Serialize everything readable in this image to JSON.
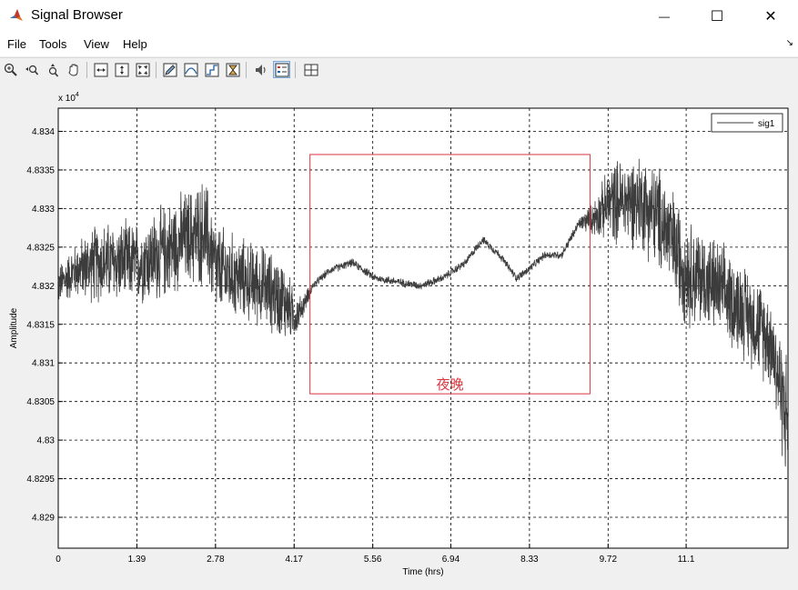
{
  "window": {
    "title": "Signal Browser",
    "minimize_glyph": "—",
    "maximize_glyph": "☐",
    "close_glyph": "✕"
  },
  "menu": [
    "File",
    "Tools",
    "View",
    "Help"
  ],
  "toolbar_icons": [
    "zoom-in-icon",
    "zoom-x-icon",
    "zoom-y-icon",
    "pan-hand-icon",
    "fit-horizontal-icon",
    "fit-vertical-icon",
    "fit-both-icon",
    "edit-annotation-icon",
    "waveform-icon",
    "step-icon",
    "hourglass-icon",
    "speaker-icon",
    "legend-toggle-icon",
    "grid-layout-icon"
  ],
  "colors": {
    "signal": "#3c3c3c",
    "annotation": "#d9363e",
    "grid": "#000000",
    "axes_bg": "#ffffff"
  },
  "chart_data": {
    "type": "line",
    "exponent_label": "x 10",
    "exponent_power": "4",
    "xlabel": "Time (hrs)",
    "ylabel": "Amplitude",
    "xlim": [
      0,
      12.9
    ],
    "ylim": [
      48286,
      48343
    ],
    "x_ticks": [
      0,
      1.39,
      2.78,
      4.17,
      5.56,
      6.94,
      8.33,
      9.72,
      11.1
    ],
    "x_tick_labels": [
      "0",
      "1.39",
      "2.78",
      "4.17",
      "5.56",
      "6.94",
      "8.33",
      "9.72",
      "11.1"
    ],
    "y_ticks": [
      48290,
      48295,
      48300,
      48305,
      48310,
      48315,
      48320,
      48325,
      48330,
      48335,
      48340
    ],
    "y_tick_labels": [
      "4.829",
      "4.8295",
      "4.83",
      "4.8305",
      "4.831",
      "4.8315",
      "4.832",
      "4.8325",
      "4.833",
      "4.8335",
      "4.834"
    ],
    "grid": true,
    "legend_position": "top-right",
    "series": [
      {
        "name": "sig1",
        "envelope": [
          [
            0.0,
            48320,
            3
          ],
          [
            0.3,
            48322,
            4
          ],
          [
            0.7,
            48323,
            6
          ],
          [
            1.0,
            48323,
            6
          ],
          [
            1.4,
            48323,
            6
          ],
          [
            1.8,
            48324,
            7
          ],
          [
            2.2,
            48326,
            7
          ],
          [
            2.6,
            48327,
            8
          ],
          [
            2.8,
            48322,
            7
          ],
          [
            3.2,
            48321,
            6
          ],
          [
            3.6,
            48320,
            6
          ],
          [
            4.0,
            48318,
            6
          ],
          [
            4.2,
            48316,
            3
          ],
          [
            4.3,
            48317,
            2
          ],
          [
            4.5,
            48320,
            0.6
          ],
          [
            4.8,
            48322,
            0.6
          ],
          [
            5.2,
            48323,
            0.6
          ],
          [
            5.6,
            48321,
            0.6
          ],
          [
            6.0,
            48320.5,
            0.6
          ],
          [
            6.4,
            48320,
            0.6
          ],
          [
            6.8,
            48321,
            0.6
          ],
          [
            7.2,
            48323,
            0.6
          ],
          [
            7.5,
            48326,
            0.6
          ],
          [
            7.8,
            48324,
            0.6
          ],
          [
            8.1,
            48321,
            0.6
          ],
          [
            8.3,
            48322,
            0.6
          ],
          [
            8.6,
            48324,
            0.6
          ],
          [
            8.9,
            48324,
            0.6
          ],
          [
            9.2,
            48328,
            0.8
          ],
          [
            9.5,
            48329,
            3
          ],
          [
            9.8,
            48331,
            6
          ],
          [
            10.3,
            48331,
            7
          ],
          [
            10.7,
            48328,
            8
          ],
          [
            11.1,
            48322,
            8
          ],
          [
            11.6,
            48320,
            7
          ],
          [
            12.1,
            48317,
            7
          ],
          [
            12.6,
            48313,
            7
          ],
          [
            12.9,
            48302,
            10
          ]
        ]
      }
    ],
    "annotation": {
      "label": "夜晚",
      "x_range": [
        4.45,
        9.4
      ],
      "y_range": [
        48306,
        48337
      ]
    }
  }
}
